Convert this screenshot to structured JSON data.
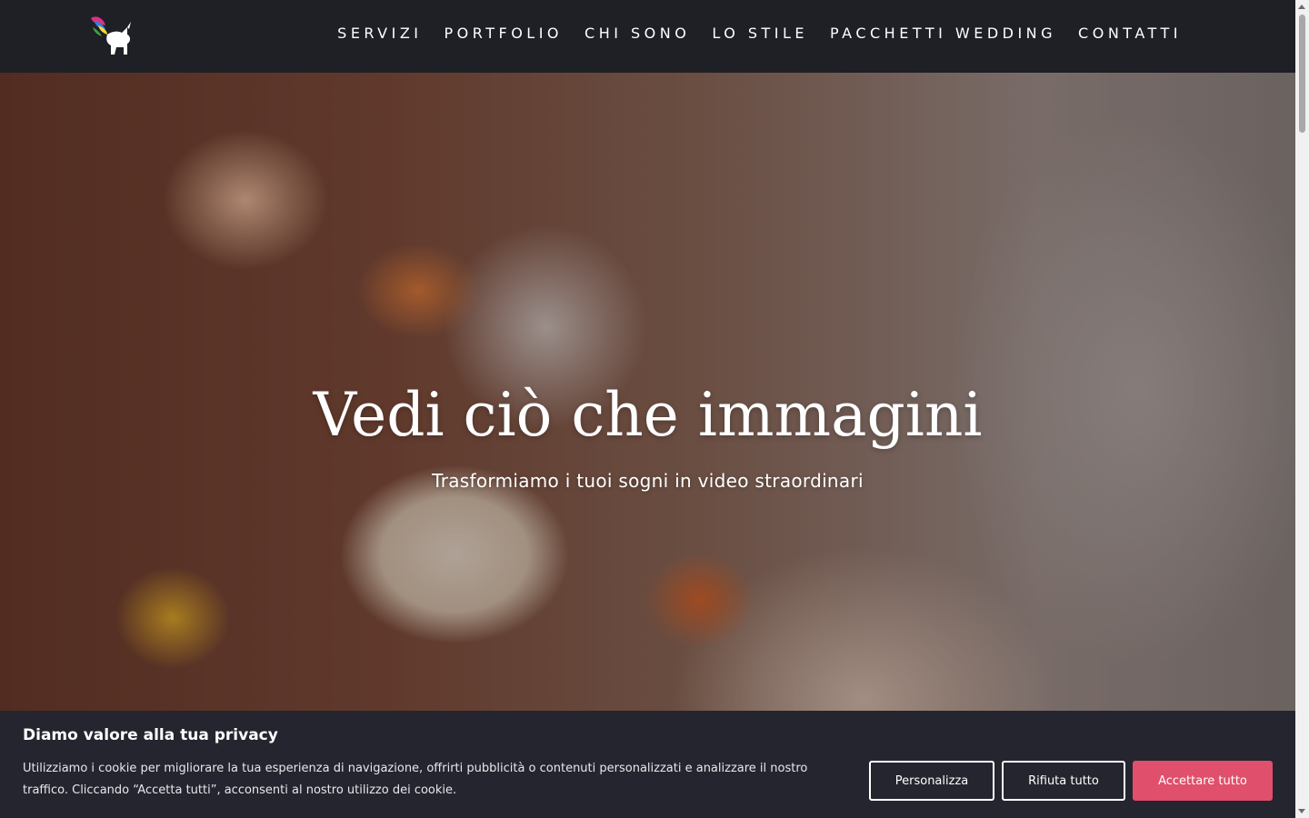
{
  "header": {
    "nav": [
      "SERVIZI",
      "PORTFOLIO",
      "CHI SONO",
      "LO STILE",
      "PACCHETTI WEDDING",
      "CONTATTI"
    ]
  },
  "hero": {
    "title": "Vedi ciò che immagini",
    "subtitle": "Trasformiamo i tuoi sogni in video straordinari"
  },
  "cookie": {
    "title": "Diamo valore alla tua privacy",
    "text": "Utilizziamo i cookie per migliorare la tua esperienza di navigazione, offrirti pubblicità o contenuti personalizzati e analizzare il nostro traffico. Cliccando “Accetta tutti”, acconsenti al nostro utilizzo dei cookie.",
    "customize": "Personalizza",
    "reject": "Rifiuta tutto",
    "accept": "Accettare tutto"
  },
  "colors": {
    "header_bg": "#1f1f26",
    "banner_bg": "#24252f",
    "accept_bg": "#e04f6b"
  },
  "icons": {
    "logo": "unicorn-goat-logo-icon"
  }
}
